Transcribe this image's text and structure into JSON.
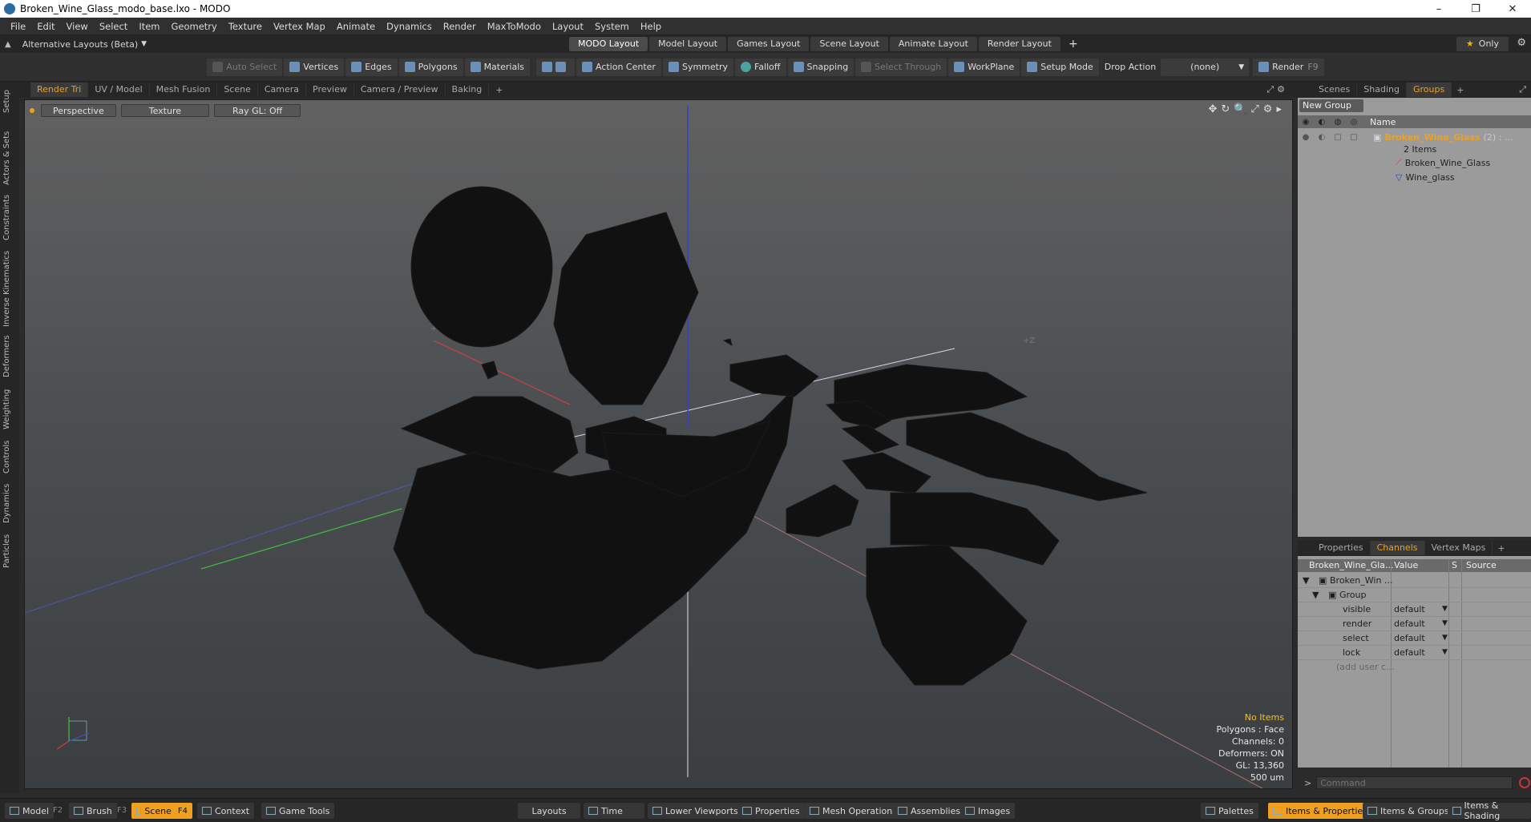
{
  "window": {
    "title": "Broken_Wine_Glass_modo_base.lxo - MODO",
    "minimize": "–",
    "maximize": "❐",
    "close": "✕"
  },
  "menu": [
    "File",
    "Edit",
    "View",
    "Select",
    "Item",
    "Geometry",
    "Texture",
    "Vertex Map",
    "Animate",
    "Dynamics",
    "Render",
    "MaxToModo",
    "Layout",
    "System",
    "Help"
  ],
  "layoutbar": {
    "alt_label": "Alternative Layouts (Beta)",
    "tabs": [
      "MODO Layout",
      "Model Layout",
      "Games Layout",
      "Scene Layout",
      "Animate Layout",
      "Render Layout"
    ],
    "active_tab": "MODO Layout",
    "plus": "+",
    "only_star": "★",
    "only_label": "Only"
  },
  "toolbar": {
    "auto_select": "Auto Select",
    "vertices": "Vertices",
    "edges": "Edges",
    "polygons": "Polygons",
    "materials": "Materials",
    "action_center": "Action Center",
    "symmetry": "Symmetry",
    "falloff": "Falloff",
    "snapping": "Snapping",
    "select_through": "Select Through",
    "workplane": "WorkPlane",
    "setup_mode": "Setup Mode",
    "drop_action_label": "Drop Action",
    "drop_action_value": "(none)",
    "render": "Render",
    "render_key": "F9"
  },
  "left_tabs": [
    "Setup",
    "Actors & Sets",
    "Constraints",
    "Inverse Kinematics",
    "Deformers",
    "Weighting",
    "Controls",
    "Dynamics",
    "Particles"
  ],
  "viewport_tabs": [
    "Render Tri",
    "UV / Model",
    "Mesh Fusion",
    "Scene",
    "Camera",
    "Preview",
    "Camera / Preview",
    "Baking"
  ],
  "viewport_tab_active": "Render Tri",
  "viewport": {
    "view_mode": "Perspective",
    "shading": "Texture",
    "raygl": "Ray GL: Off",
    "axis_x_label": "+X",
    "axis_z_label": "+Z",
    "info": {
      "no_items": "No Items",
      "polygons": "Polygons : Face",
      "channels": "Channels: 0",
      "deformers": "Deformers: ON",
      "gl": "GL: 13,360",
      "unit": "500 um"
    }
  },
  "right_tabs": [
    "Scenes",
    "Shading",
    "Groups"
  ],
  "right_tab_active": "Groups",
  "groups": {
    "new_group": "New Group",
    "col_name": "Name",
    "root_name": "Broken_Wine_Glass",
    "root_count": "(2) : ...",
    "root_items": "2 Items",
    "children": [
      "Broken_Wine_Glass",
      "Wine_glass"
    ]
  },
  "prop_tabs": [
    "Properties",
    "Channels",
    "Vertex Maps"
  ],
  "prop_tab_active": "Channels",
  "channels": {
    "col_item": "Broken_Wine_Gla...",
    "col_value": "Value",
    "col_s": "S",
    "col_source": "Source",
    "root": "Broken_Win ...",
    "group": "Group",
    "rows": [
      {
        "name": "visible",
        "value": "default"
      },
      {
        "name": "render",
        "value": "default"
      },
      {
        "name": "select",
        "value": "default"
      },
      {
        "name": "lock",
        "value": "default"
      }
    ],
    "add_user": "(add user c..."
  },
  "command_placeholder": "Command",
  "bottombar": {
    "model": "Model",
    "model_key": "F2",
    "brush": "Brush",
    "brush_key": "F3",
    "scene": "Scene",
    "scene_key": "F4",
    "context": "Context",
    "game_tools": "Game Tools",
    "layouts": "Layouts",
    "time": "Time",
    "lower_viewports": "Lower Viewports",
    "properties": "Properties",
    "mesh_operations": "Mesh Operations",
    "assemblies": "Assemblies",
    "images": "Images",
    "palettes": "Palettes",
    "items_properties": "Items & Properties",
    "items_groups": "Items & Groups",
    "items_shading": "Items & Shading"
  },
  "colors": {
    "accent": "#f0a020",
    "axis_x": "#d04040",
    "axis_y": "#3a50d0",
    "axis_z": "#40c040",
    "mesh": "#111111"
  }
}
